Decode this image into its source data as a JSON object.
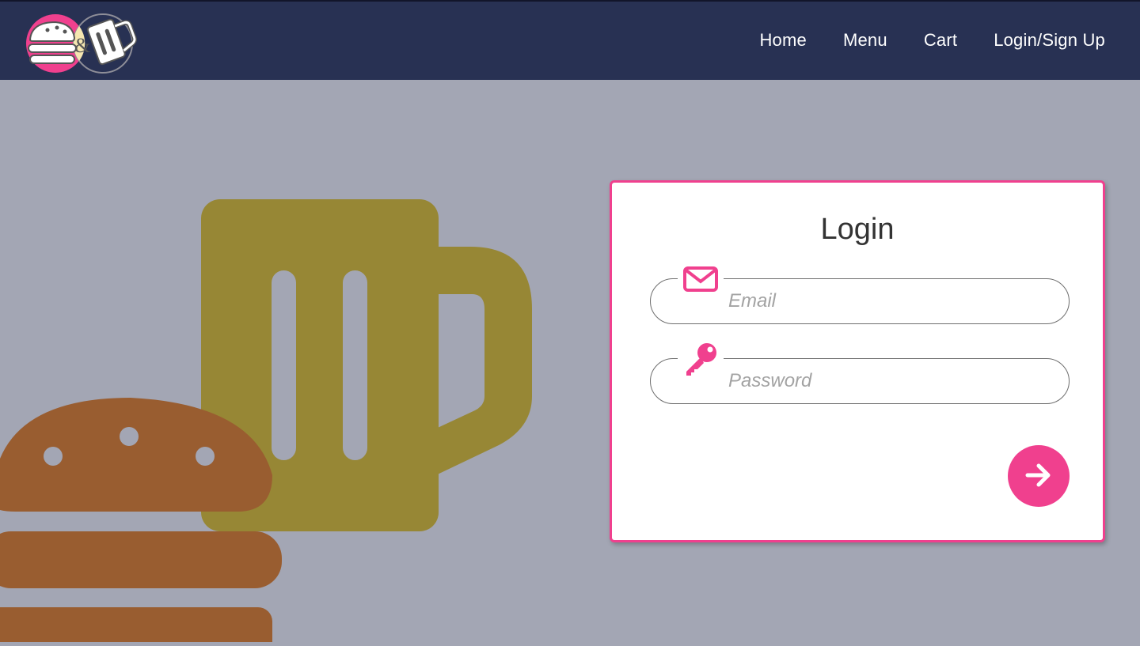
{
  "app": {
    "logo_name": "burger-and-beer-logo"
  },
  "nav": {
    "links": [
      {
        "label": "Home"
      },
      {
        "label": "Menu"
      },
      {
        "label": "Cart"
      },
      {
        "label": "Login/Sign Up"
      }
    ]
  },
  "login": {
    "title": "Login",
    "email": {
      "placeholder": "Email",
      "value": "",
      "icon": "envelope-icon"
    },
    "password": {
      "placeholder": "Password",
      "value": "",
      "icon": "key-icon"
    },
    "submit_icon": "arrow-right-icon"
  },
  "colors": {
    "navbar": "#283153",
    "background": "#a3a6b4",
    "accent": "#f0408e",
    "beer": "#978735",
    "burger": "#995d30"
  }
}
